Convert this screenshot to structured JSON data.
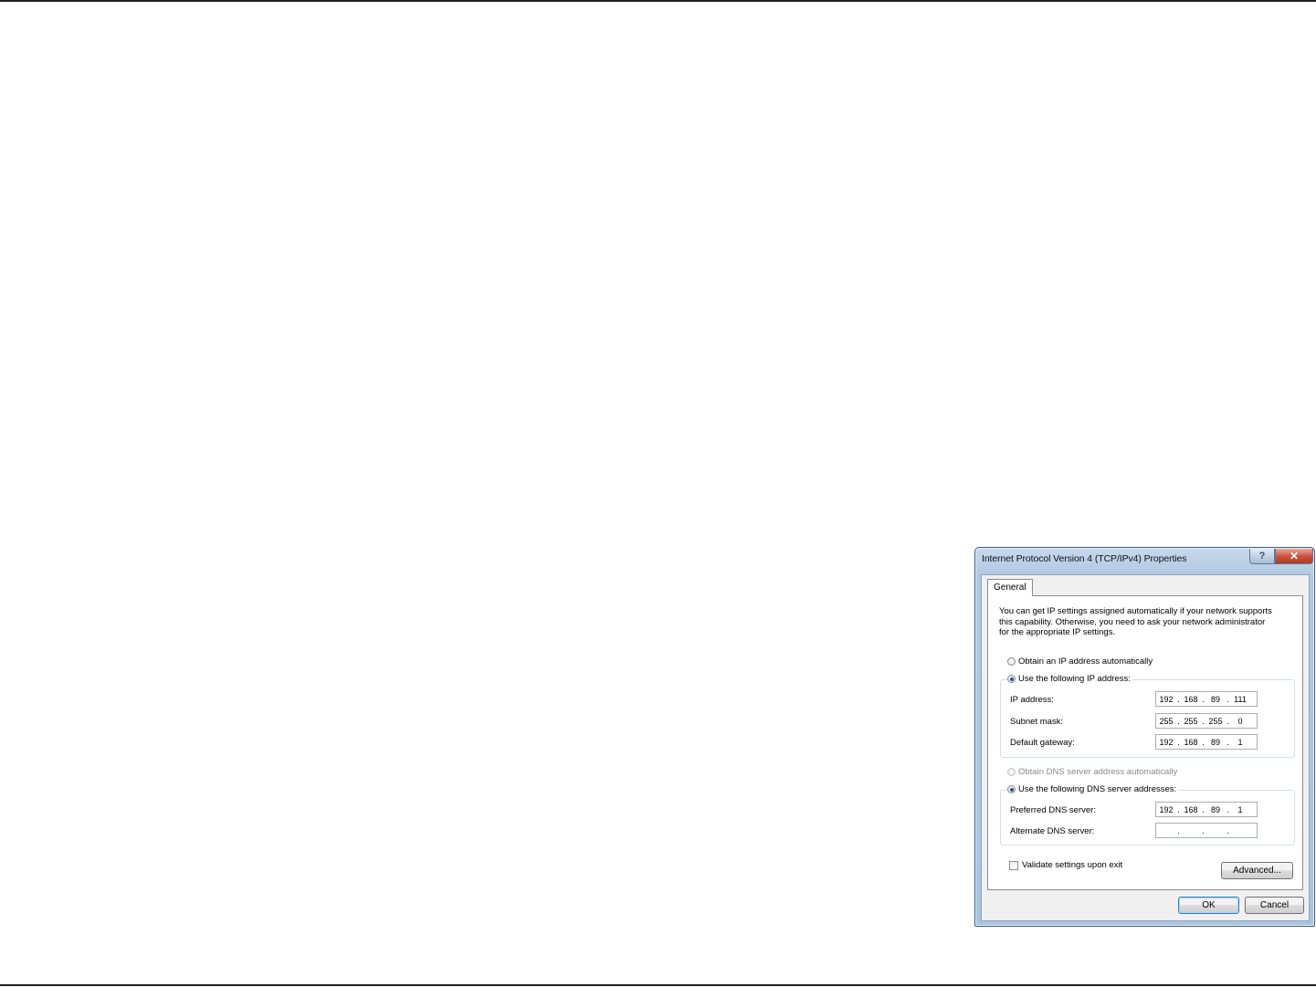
{
  "dialog": {
    "title": "Internet Protocol Version 4 (TCP/IPv4) Properties",
    "help_label": "?",
    "close_label": "✕",
    "tab_general": "General",
    "description": [
      "You can get IP settings assigned automatically if your network supports",
      "this capability. Otherwise, you need to ask your network administrator",
      "for the appropriate IP settings."
    ],
    "ip_mode": {
      "auto_label": "Obtain an IP address automatically",
      "manual_label": "Use the following IP address:",
      "selected": "manual"
    },
    "ip_fields": {
      "ip_address": {
        "label": "IP address:",
        "octets": [
          "192",
          "168",
          "89",
          "111"
        ]
      },
      "subnet_mask": {
        "label": "Subnet mask:",
        "octets": [
          "255",
          "255",
          "255",
          "0"
        ]
      },
      "default_gateway": {
        "label": "Default gateway:",
        "octets": [
          "192",
          "168",
          "89",
          "1"
        ]
      }
    },
    "dns_mode": {
      "auto_label": "Obtain DNS server address automatically",
      "manual_label": "Use the following DNS server addresses:",
      "selected": "manual"
    },
    "dns_fields": {
      "preferred": {
        "label": "Preferred DNS server:",
        "octets": [
          "192",
          "168",
          "89",
          "1"
        ]
      },
      "alternate": {
        "label": "Alternate DNS server:",
        "octets": [
          "",
          "",
          "",
          ""
        ]
      }
    },
    "validate_label": "Validate settings upon exit",
    "advanced_label": "Advanced...",
    "ok_label": "OK",
    "cancel_label": "Cancel"
  }
}
